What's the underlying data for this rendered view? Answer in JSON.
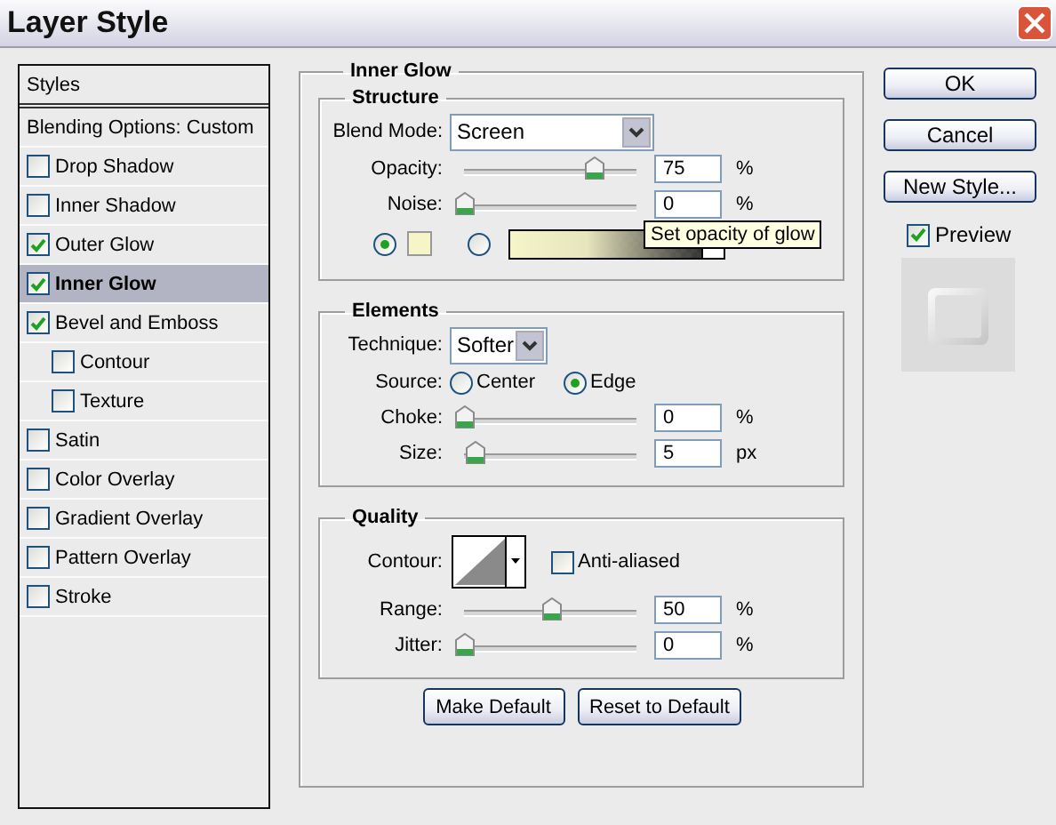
{
  "window": {
    "title": "Layer Style"
  },
  "sidebar": {
    "header": "Styles",
    "blending_options": "Blending Options: Custom",
    "items": [
      {
        "label": "Drop Shadow",
        "checked": false,
        "selected": false
      },
      {
        "label": "Inner Shadow",
        "checked": false,
        "selected": false
      },
      {
        "label": "Outer Glow",
        "checked": true,
        "selected": false
      },
      {
        "label": "Inner Glow",
        "checked": true,
        "selected": true
      },
      {
        "label": "Bevel and Emboss",
        "checked": true,
        "selected": false,
        "children": [
          {
            "label": "Contour",
            "checked": false,
            "selected": false
          },
          {
            "label": "Texture",
            "checked": false,
            "selected": false
          }
        ]
      },
      {
        "label": "Satin",
        "checked": false,
        "selected": false
      },
      {
        "label": "Color Overlay",
        "checked": false,
        "selected": false
      },
      {
        "label": "Gradient Overlay",
        "checked": false,
        "selected": false
      },
      {
        "label": "Pattern Overlay",
        "checked": false,
        "selected": false
      },
      {
        "label": "Stroke",
        "checked": false,
        "selected": false
      }
    ]
  },
  "inner_glow": {
    "title": "Inner Glow",
    "structure": {
      "title": "Structure",
      "blend_mode": {
        "label": "Blend Mode:",
        "value": "Screen"
      },
      "sliders": [
        {
          "label": "Opacity:",
          "level": 0.75,
          "value": "75",
          "unit": "%"
        },
        {
          "label": "Noise:",
          "level": 0,
          "value": "0",
          "unit": "%"
        }
      ],
      "fill": [
        {
          "kind": "color",
          "selected": true
        },
        {
          "kind": "gradient",
          "selected": false
        }
      ]
    },
    "elements": {
      "title": "Elements",
      "technique": {
        "label": "Technique:",
        "value": "Softer"
      },
      "source": {
        "label": "Source:",
        "options": [
          {
            "label": "Center",
            "selected": false
          },
          {
            "label": "Edge",
            "selected": true
          }
        ]
      },
      "sliders": [
        {
          "label": "Choke:",
          "level": 0,
          "value": "0",
          "unit": "%"
        },
        {
          "label": "Size:",
          "level": 0.06,
          "value": "5",
          "unit": "px"
        }
      ]
    },
    "quality": {
      "title": "Quality",
      "contour": {
        "label": "Contour:"
      },
      "anti_aliased": {
        "label": "Anti-aliased",
        "checked": false
      },
      "sliders": [
        {
          "label": "Range:",
          "level": 0.5,
          "value": "50",
          "unit": "%"
        },
        {
          "label": "Jitter:",
          "level": 0,
          "value": "0",
          "unit": "%"
        }
      ]
    },
    "buttons": [
      "Make Default",
      "Reset to Default"
    ]
  },
  "actions": {
    "buttons": [
      "OK",
      "Cancel",
      "New Style..."
    ],
    "preview": {
      "label": "Preview",
      "checked": true
    }
  },
  "tooltip": {
    "text": "Set opacity of glow"
  }
}
